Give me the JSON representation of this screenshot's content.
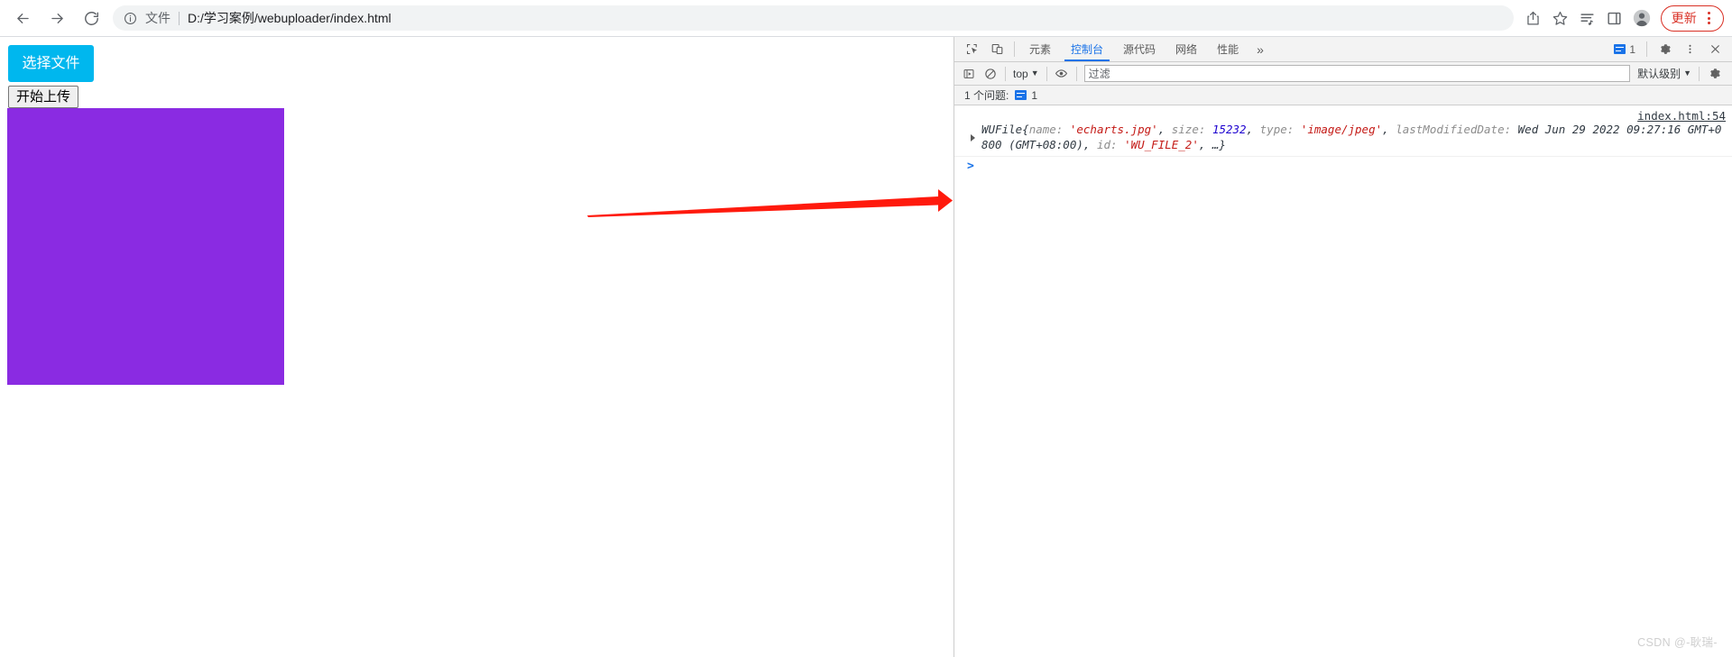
{
  "browser": {
    "nav": {
      "back_title": "后退",
      "forward_title": "前进",
      "reload_title": "重新加载"
    },
    "omnibox": {
      "info_icon": "info-circle-icon",
      "scheme_label": "文件",
      "url": "D:/学习案例/webuploader/index.html"
    },
    "actions": {
      "share_icon": "share-icon",
      "bookmark_icon": "star-icon",
      "reading_list_icon": "reading-list-icon",
      "side_panel_icon": "side-panel-icon",
      "profile_icon": "profile-avatar-icon",
      "update_label": "更新",
      "menu_icon": "kebab-menu-icon"
    }
  },
  "page": {
    "select_file_label": "选择文件",
    "start_upload_label": "开始上传",
    "thumbnail_color": "#8a2be2",
    "annotation_arrow_color": "#ff1a0d"
  },
  "devtools": {
    "tools": {
      "inspect_icon": "inspect-element-icon",
      "device_toolbar_icon": "device-toolbar-icon"
    },
    "tabs": [
      {
        "label": "元素",
        "active": false
      },
      {
        "label": "控制台",
        "active": true
      },
      {
        "label": "源代码",
        "active": false
      },
      {
        "label": "网络",
        "active": false
      },
      {
        "label": "性能",
        "active": false
      }
    ],
    "more_tabs_label": "»",
    "issues_counter": {
      "icon": "issue-message-icon",
      "count": "1"
    },
    "settings_icon": "gear-icon",
    "menu_icon": "kebab-menu-icon",
    "close_icon": "close-icon",
    "console_toolbar": {
      "sidebar_icon": "console-sidebar-icon",
      "clear_icon": "clear-console-icon",
      "context_label": "top",
      "eye_icon": "live-expression-eye-icon",
      "filter_placeholder": "过滤",
      "filter_value": "",
      "level_label": "默认级别",
      "settings_icon": "gear-icon"
    },
    "issues_bar": {
      "text": "1 个问题:",
      "count": "1"
    },
    "console": {
      "source_link": "index.html:54",
      "message": {
        "class_name": "WUFile",
        "open_brace": "{",
        "k_name": "name:",
        "v_name": "'echarts.jpg'",
        "k_size": "size:",
        "v_size": "15232",
        "k_type": "type:",
        "v_type": "'image/jpeg'",
        "k_lastmod": "lastModifiedDate:",
        "v_lastmod": "Wed Jun 29 2022 09:27:16 GMT+0800 (GMT+08:00)",
        "k_id": "id:",
        "v_id": "'WU_FILE_2'",
        "ellipsis": ", …}"
      },
      "prompt_caret": ">"
    }
  },
  "watermark": "CSDN @-耿瑞-"
}
